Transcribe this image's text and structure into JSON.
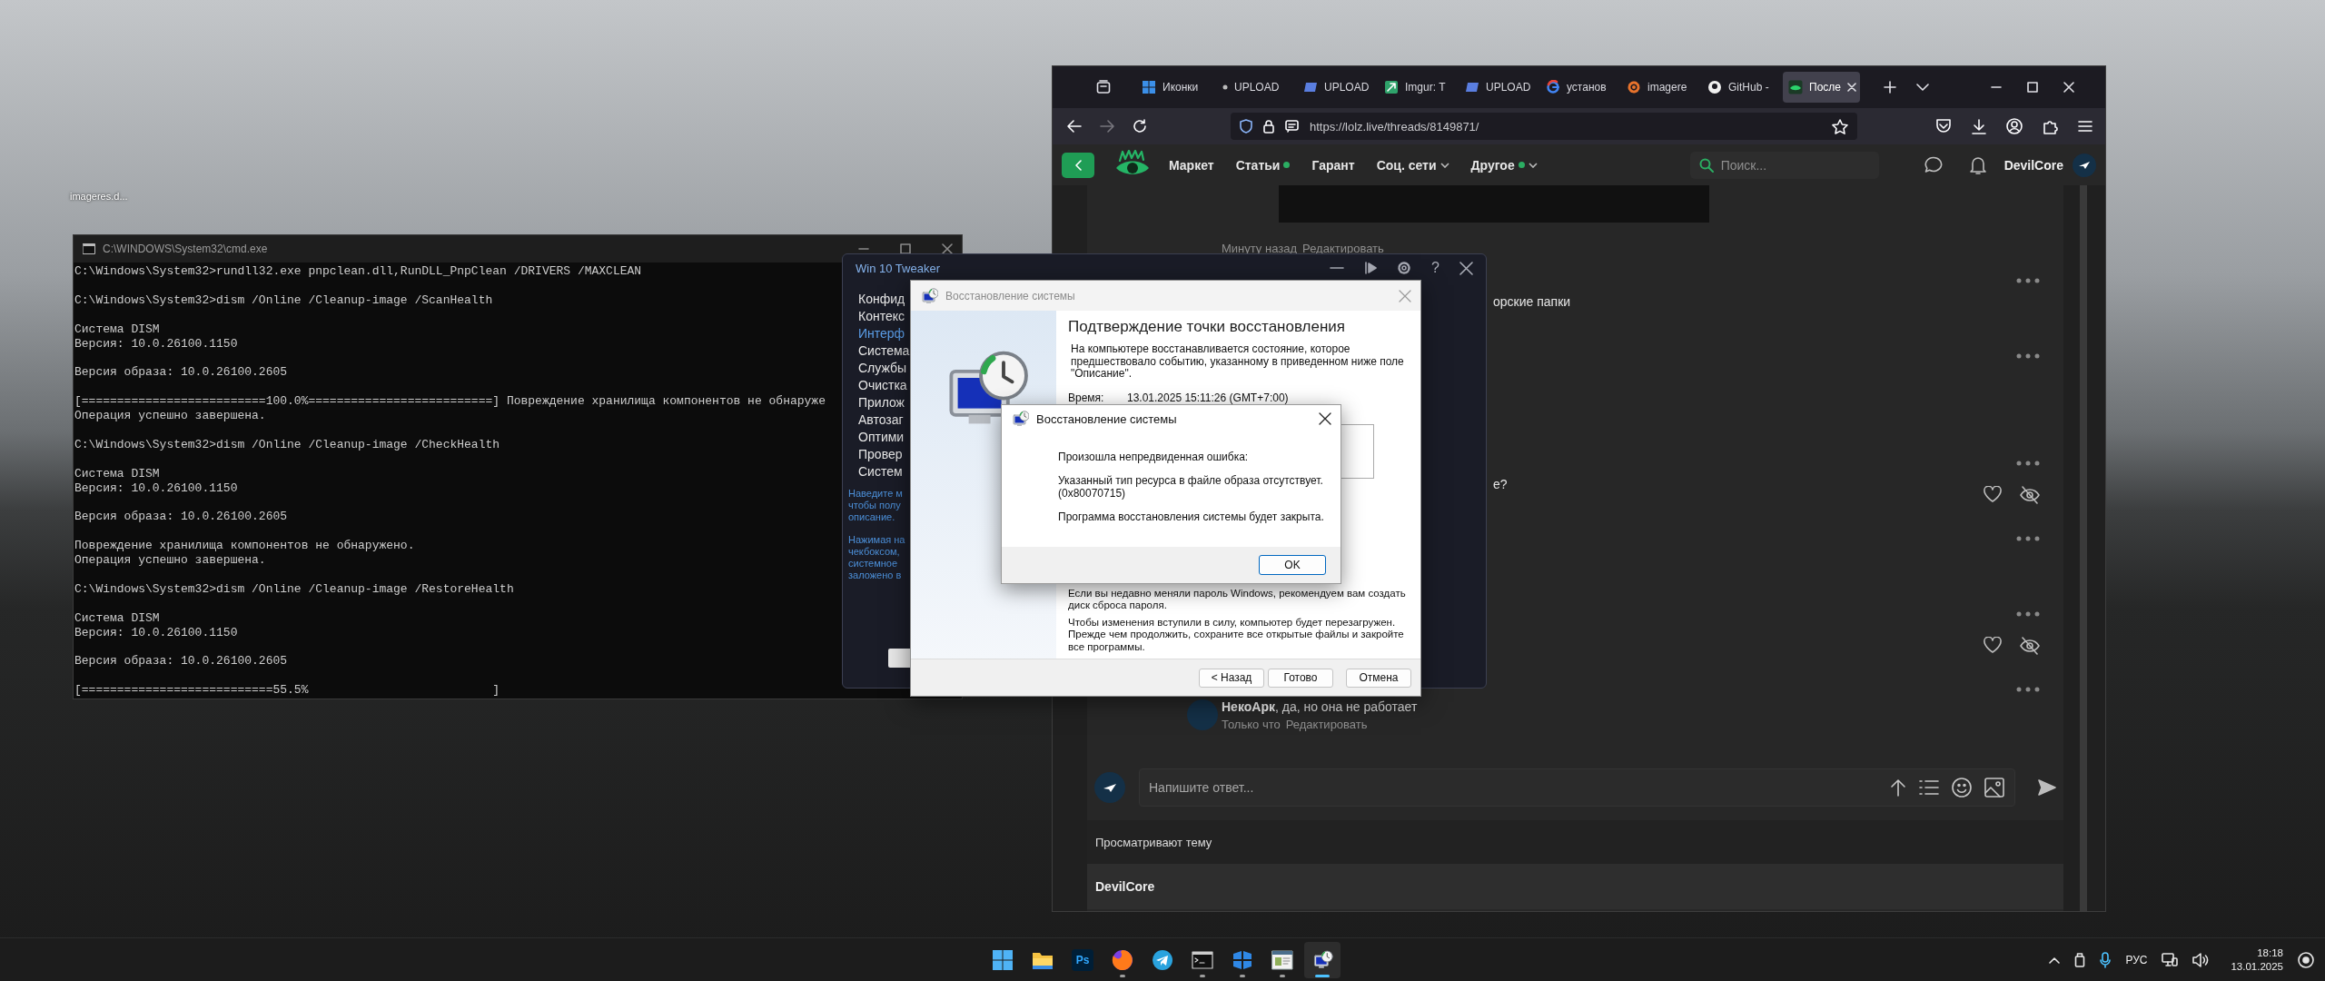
{
  "desktop": {
    "icons": [
      {
        "label": "imageres.d..."
      }
    ]
  },
  "cmd": {
    "title": "C:\\WINDOWS\\System32\\cmd.exe",
    "blocks": [
      [
        "C:\\Windows\\System32>rundll32.exe pnpclean.dll,RunDLL_PnpClean /DRIVERS /MAXCLEAN"
      ],
      [
        "C:\\Windows\\System32>dism /Online /Cleanup-image /ScanHealth"
      ],
      [
        "Система DISM",
        "Версия: 10.0.26100.1150"
      ],
      [
        "Версия образа: 10.0.26100.2605"
      ],
      [
        "[==========================100.0%==========================] Повреждение хранилища компонентов не обнаруже",
        "Операция успешно завершена."
      ],
      [
        "C:\\Windows\\System32>dism /Online /Cleanup-image /CheckHealth"
      ],
      [
        "Система DISM",
        "Версия: 10.0.26100.1150"
      ],
      [
        "Версия образа: 10.0.26100.2605"
      ],
      [
        "Повреждение хранилища компонентов не обнаружено.",
        "Операция успешно завершена."
      ],
      [
        "C:\\Windows\\System32>dism /Online /Cleanup-image /RestoreHealth"
      ],
      [
        "Система DISM",
        "Версия: 10.0.26100.1150"
      ],
      [
        "Версия образа: 10.0.26100.2605"
      ],
      [
        "[===========================55.5%                          ]"
      ]
    ]
  },
  "browser": {
    "tabs": [
      {
        "kind": "windows",
        "label": "Иконки",
        "selected": false
      },
      {
        "kind": "dot",
        "label": "UPLOAD",
        "selected": false
      },
      {
        "kind": "up",
        "label": "UPLOAD",
        "selected": false
      },
      {
        "kind": "imgur",
        "label": "Imgur: T",
        "selected": false
      },
      {
        "kind": "up",
        "label": "UPLOAD",
        "selected": false
      },
      {
        "kind": "google",
        "label": "установ",
        "selected": false
      },
      {
        "kind": "gear",
        "label": "imagere",
        "selected": false
      },
      {
        "kind": "github",
        "label": "GitHub -",
        "selected": false
      },
      {
        "kind": "site",
        "label": "После",
        "selected": true
      }
    ],
    "url": "https://lolz.live/threads/8149871/",
    "site": {
      "nav": [
        {
          "label": "Маркет",
          "dot": false,
          "dropdown": false
        },
        {
          "label": "Статьи",
          "dot": true,
          "dropdown": false
        },
        {
          "label": "Гарант",
          "dot": false,
          "dropdown": false
        },
        {
          "label": "Соц. сети",
          "dot": false,
          "dropdown": true
        },
        {
          "label": "Другое",
          "dot": true,
          "dropdown": true
        }
      ],
      "search": {
        "placeholder": "Поиск..."
      },
      "user": "DevilCore"
    },
    "post_meta": [
      "Минуту назад",
      "Редактировать"
    ],
    "messages": [
      {
        "text": "орские папки",
        "reactions": false
      },
      {
        "reactions": false
      },
      {
        "text": "е?",
        "reactions": true
      },
      {
        "reactions": false
      },
      {
        "reactions": true
      }
    ],
    "last_message": {
      "text": "**НекоАрк**, да, но она не работает",
      "meta": [
        "Только что",
        "Редактировать"
      ]
    },
    "reply": {
      "placeholder": "Напишите ответ..."
    },
    "viewers": {
      "title": "Просматривают тему",
      "users": [
        "DevilCore"
      ]
    }
  },
  "tweaker": {
    "title": "Win 10 Tweaker",
    "help_glyph": "?",
    "menu": [
      {
        "label": "Конфид",
        "selected": false
      },
      {
        "label": "Контекс",
        "selected": false
      },
      {
        "label": "Интерф",
        "selected": true
      },
      {
        "label": "Система",
        "selected": false
      },
      {
        "label": "Службы",
        "selected": false
      },
      {
        "label": "Очистка",
        "selected": false
      },
      {
        "label": "Прилож",
        "selected": false
      },
      {
        "label": "Автозаг",
        "selected": false
      },
      {
        "label": "Оптими",
        "selected": false
      },
      {
        "label": "Провер",
        "selected": false
      },
      {
        "label": "Систем",
        "selected": false
      }
    ],
    "hints": [
      [
        "Наведите м",
        "чтобы полу",
        "описание."
      ],
      [
        "Нажимая на",
        "чекбоксом,",
        "системное",
        "заложено в"
      ]
    ]
  },
  "restore_wizard": {
    "title": "Восстановление системы",
    "heading": "Подтверждение точки восстановления",
    "intro": "На компьютере восстанавливается состояние, которое предшествовало событию, указанному в приведенном ниже поле \"Описание\".",
    "fields": [
      {
        "label": "Время:",
        "value": "13.01.2025 15:11:26 (GMT+7:00)"
      }
    ],
    "notes": [
      "Если вы недавно меняли пароль Windows, рекомендуем вам создать диск сброса пароля.",
      "Чтобы изменения вступили в силу, компьютер будет перезагружен. Прежде чем продолжить, сохраните все открытые файлы и закройте все программы."
    ],
    "buttons": [
      "< Назад",
      "Готово",
      "Отмена"
    ]
  },
  "error_dialog": {
    "title": "Восстановление системы",
    "messages": [
      "Произошла непредвиденная ошибка:",
      "Указанный тип ресурса в файле образа отсутствует. (0x80070715)",
      "Программа восстановления системы будет закрыта."
    ],
    "button": "OK"
  },
  "taskbar": {
    "apps": [
      {
        "kind": "start",
        "running": false,
        "selected": false
      },
      {
        "kind": "explorer",
        "running": false,
        "selected": false
      },
      {
        "kind": "photoshop",
        "label": "Ps",
        "running": false,
        "selected": false
      },
      {
        "kind": "firefox",
        "running": true,
        "selected": false
      },
      {
        "kind": "telegram",
        "running": false,
        "selected": false
      },
      {
        "kind": "terminal",
        "running": true,
        "selected": false
      },
      {
        "kind": "tweaker",
        "running": true,
        "selected": false
      },
      {
        "kind": "window",
        "running": true,
        "selected": false
      },
      {
        "kind": "restore",
        "running": true,
        "selected": true
      }
    ],
    "tray": {
      "language": "РУС",
      "time": "18:18",
      "date": "13.01.2025"
    }
  }
}
